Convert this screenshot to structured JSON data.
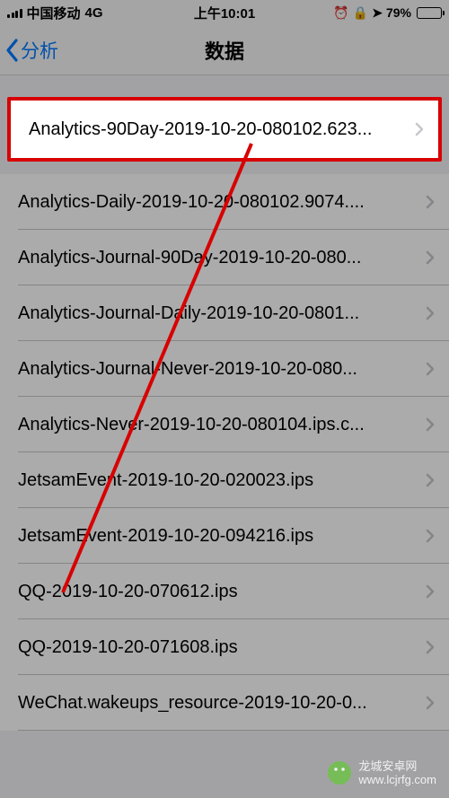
{
  "statusBar": {
    "carrier": "中国移动",
    "network": "4G",
    "time": "上午10:01",
    "batteryText": "79%",
    "batteryFill": "79%"
  },
  "nav": {
    "backLabel": "分析",
    "title": "数据"
  },
  "highlightedRow": {
    "label": "Analytics-90Day-2019-10-20-080102.623..."
  },
  "rows": [
    {
      "label": "Analytics-Daily-2019-10-20-080102.9074...."
    },
    {
      "label": "Analytics-Journal-90Day-2019-10-20-080..."
    },
    {
      "label": "Analytics-Journal-Daily-2019-10-20-0801..."
    },
    {
      "label": "Analytics-Journal-Never-2019-10-20-080..."
    },
    {
      "label": "Analytics-Never-2019-10-20-080104.ips.c..."
    },
    {
      "label": "JetsamEvent-2019-10-20-020023.ips"
    },
    {
      "label": "JetsamEvent-2019-10-20-094216.ips"
    },
    {
      "label": "QQ-2019-10-20-070612.ips"
    },
    {
      "label": "QQ-2019-10-20-071608.ips"
    },
    {
      "label": "WeChat.wakeups_resource-2019-10-20-0..."
    }
  ],
  "watermark": {
    "name": "龙城安卓网",
    "url": "www.lcjrfg.com"
  }
}
